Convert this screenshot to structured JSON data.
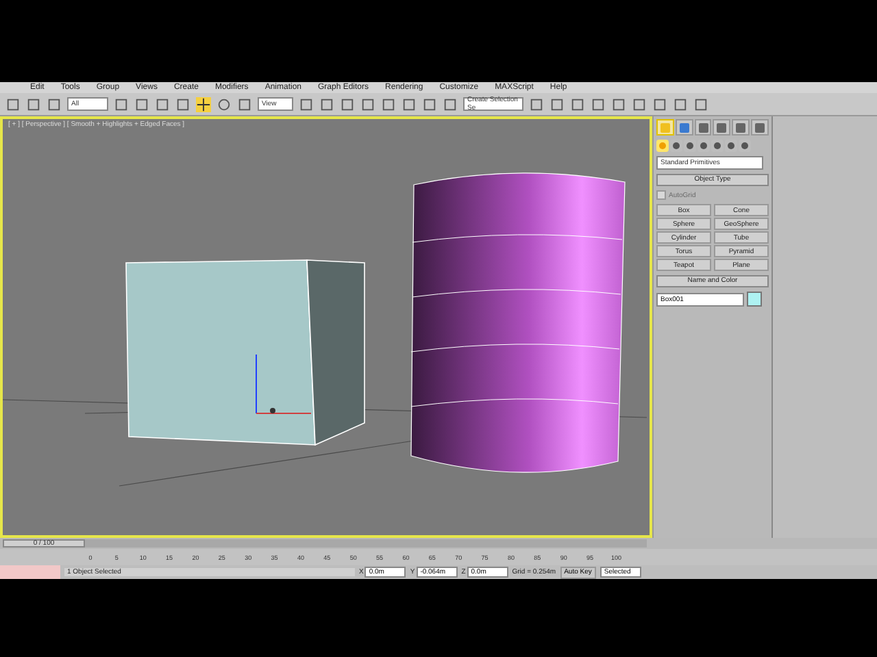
{
  "menu": [
    "Edit",
    "Tools",
    "Group",
    "Views",
    "Create",
    "Modifiers",
    "Animation",
    "Graph Editors",
    "Rendering",
    "Customize",
    "MAXScript",
    "Help"
  ],
  "toolbar": {
    "selection_filter": "All",
    "reference_coord": "View",
    "named_selection": "Create Selection Se"
  },
  "viewport": {
    "label": "[ + ] [ Perspective ] [ Smooth + Highlights + Edged Faces ]",
    "active": true
  },
  "command_panel": {
    "tabs": [
      {
        "selected": true
      },
      {
        "selected": false
      },
      {
        "selected": false
      },
      {
        "selected": false
      },
      {
        "selected": false
      },
      {
        "selected": false
      }
    ],
    "categories": [
      {
        "selected": true
      },
      {
        "selected": false
      },
      {
        "selected": false
      },
      {
        "selected": false
      },
      {
        "selected": false
      },
      {
        "selected": false
      },
      {
        "selected": false
      }
    ],
    "dropdown": "Standard Primitives",
    "object_type": {
      "title": "Object Type",
      "autogrid": {
        "label": "AutoGrid",
        "checked": false,
        "disabled": true
      },
      "buttons": [
        "Box",
        "Cone",
        "Sphere",
        "GeoSphere",
        "Cylinder",
        "Tube",
        "Torus",
        "Pyramid",
        "Teapot",
        "Plane"
      ]
    },
    "name_and_color": {
      "title": "Name and Color",
      "name": "Box001",
      "color": "#aef2f2"
    }
  },
  "time_slider": {
    "reading": "0 / 100",
    "level": 0
  },
  "track_ticks": [
    "0",
    "5",
    "10",
    "15",
    "20",
    "25",
    "30",
    "35",
    "40",
    "45",
    "50",
    "55",
    "60",
    "65",
    "70",
    "75",
    "80",
    "85",
    "90",
    "95",
    "100"
  ],
  "status": {
    "message": "1 Object Selected",
    "x_label": "X",
    "x": "0.0m",
    "y_label": "Y",
    "y": "-0.064m",
    "z_label": "Z",
    "z": "0.0m",
    "grid": "Grid = 0.254m",
    "auto_key": "Auto Key",
    "key_filter": "Selected"
  }
}
